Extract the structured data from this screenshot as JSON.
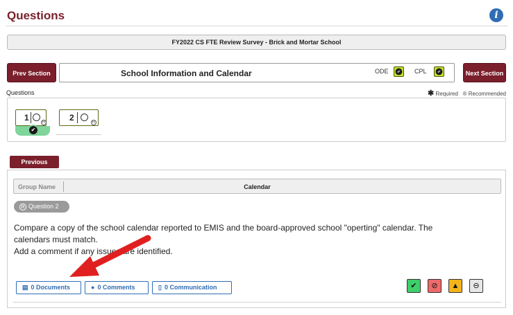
{
  "header": {
    "title": "Questions",
    "info_icon": "info-icon"
  },
  "survey": {
    "title": "FY2022 CS FTE Review Survey - Brick and Mortar School"
  },
  "section": {
    "prev_label": "Prev Section",
    "title": "School Information and Calendar",
    "next_label": "Next Section",
    "flags": [
      {
        "label": "ODE",
        "checked": true
      },
      {
        "label": "CPL",
        "checked": true
      }
    ]
  },
  "questions_label": "Questions",
  "legend": {
    "required": "Required",
    "recommended": "Recommended"
  },
  "question_tiles": [
    {
      "number": "1",
      "status": "complete",
      "selected": false
    },
    {
      "number": "2",
      "status": "none",
      "selected": true
    }
  ],
  "previous_label": "Previous",
  "group": {
    "label": "Group Name",
    "value": "Calendar"
  },
  "question": {
    "pill": "Question 2",
    "line1": "Compare a copy of the school calendar reported to EMIS and the board-approved school \"operting\" calendar. The",
    "line2": "calendars must match.",
    "line3": "Add a comment if any issues are identified."
  },
  "actions": [
    {
      "count": "0",
      "label": "Documents",
      "icon": "document-icon"
    },
    {
      "count": "0",
      "label": "Comments",
      "icon": "comment-icon"
    },
    {
      "count": "0",
      "label": "Communication",
      "icon": "mobile-icon"
    }
  ],
  "status_buttons": [
    {
      "icon": "check-clipboard-icon",
      "color": "#3ecf6a"
    },
    {
      "icon": "cancel-icon",
      "color": "#ee6a6a"
    },
    {
      "icon": "warning-icon",
      "color": "#f3b31a"
    },
    {
      "icon": "minus-circle-icon",
      "color": "#e7e7e7"
    }
  ],
  "colors": {
    "brand": "#7a1f2b",
    "accent": "#2f6db5",
    "annotation_arrow": "#e02020"
  }
}
